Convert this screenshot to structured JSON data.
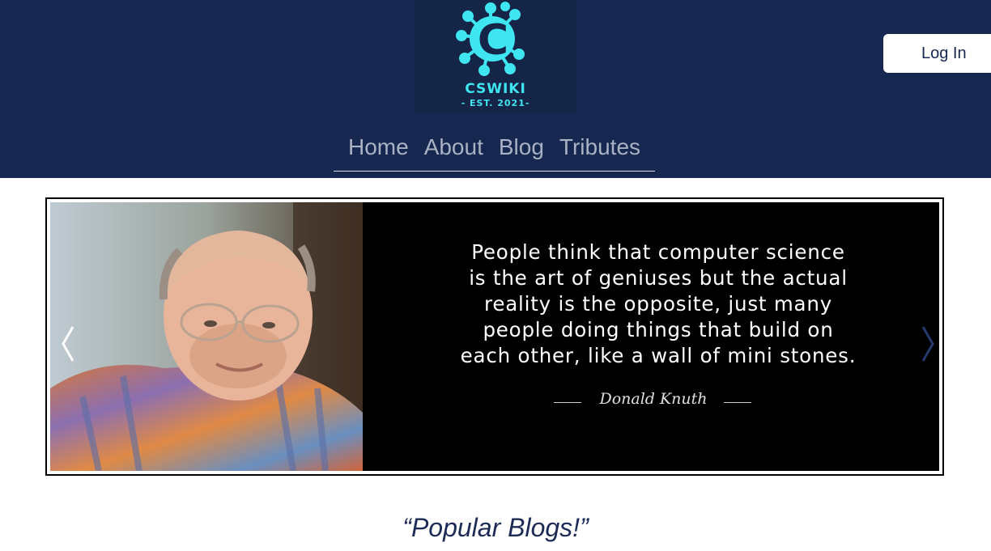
{
  "header": {
    "logo": {
      "letter": "C",
      "name": "CSWIKI",
      "est": "- EST. 2021-"
    },
    "login_label": "Log In",
    "nav": [
      {
        "label": "Home"
      },
      {
        "label": "About"
      },
      {
        "label": "Blog"
      },
      {
        "label": "Tributes"
      }
    ]
  },
  "carousel": {
    "quote_lines": [
      "People think that computer science",
      "is the art of geniuses but the actual",
      "reality is the opposite, just many",
      "people doing things that build on",
      "each other, like a wall of mini stones."
    ],
    "author": "Donald Knuth",
    "prev_icon": "chevron-left-icon",
    "next_icon": "chevron-right-icon"
  },
  "section_title": "“Popular Blogs!”",
  "colors": {
    "header_bg": "#162750",
    "logo_accent": "#3fe6f2",
    "nav_text": "#a9b1c3",
    "title_text": "#1b2b55"
  }
}
